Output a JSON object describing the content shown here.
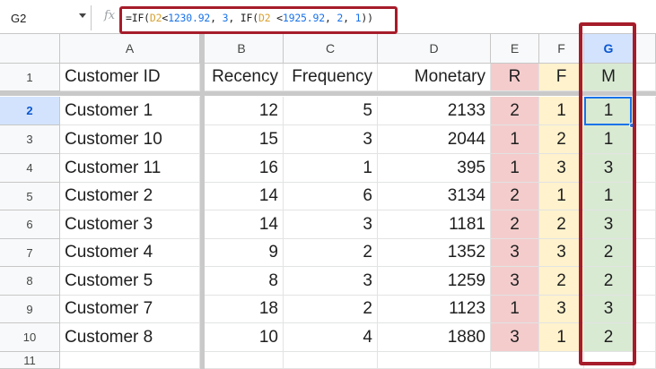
{
  "name_box": {
    "value": "G2"
  },
  "formula_bar": {
    "fx_label": "fx",
    "parts": [
      {
        "text": "=IF(",
        "kind": "plain"
      },
      {
        "text": "D2",
        "kind": "ref"
      },
      {
        "text": "<",
        "kind": "plain"
      },
      {
        "text": "1230.92",
        "kind": "num"
      },
      {
        "text": ", ",
        "kind": "plain"
      },
      {
        "text": "3",
        "kind": "num"
      },
      {
        "text": ", IF(",
        "kind": "plain"
      },
      {
        "text": "D2",
        "kind": "ref"
      },
      {
        "text": " <",
        "kind": "plain"
      },
      {
        "text": "1925.92",
        "kind": "num"
      },
      {
        "text": ", ",
        "kind": "plain"
      },
      {
        "text": "2",
        "kind": "num"
      },
      {
        "text": ", ",
        "kind": "plain"
      },
      {
        "text": "1",
        "kind": "num"
      },
      {
        "text": "))",
        "kind": "plain"
      }
    ]
  },
  "columns": [
    "A",
    "B",
    "C",
    "D",
    "E",
    "F",
    "G"
  ],
  "active_column": "G",
  "active_row": "2",
  "row_numbers": [
    "1",
    "2",
    "3",
    "4",
    "5",
    "6",
    "7",
    "8",
    "9",
    "10",
    "11"
  ],
  "header_row": [
    "Customer ID",
    "Recency",
    "Frequency",
    "Monetary",
    "R",
    "F",
    "M"
  ],
  "rows": [
    [
      "Customer 1",
      "12",
      "5",
      "2133",
      "2",
      "1",
      "1"
    ],
    [
      "Customer 10",
      "15",
      "3",
      "2044",
      "1",
      "2",
      "1"
    ],
    [
      "Customer 11",
      "16",
      "1",
      "395",
      "1",
      "3",
      "3"
    ],
    [
      "Customer 2",
      "14",
      "6",
      "3134",
      "2",
      "1",
      "1"
    ],
    [
      "Customer 3",
      "14",
      "3",
      "1181",
      "2",
      "2",
      "3"
    ],
    [
      "Customer 4",
      "9",
      "2",
      "1352",
      "3",
      "3",
      "2"
    ],
    [
      "Customer 5",
      "8",
      "3",
      "1259",
      "3",
      "2",
      "2"
    ],
    [
      "Customer 7",
      "18",
      "2",
      "1123",
      "1",
      "3",
      "3"
    ],
    [
      "Customer 8",
      "10",
      "4",
      "1880",
      "3",
      "1",
      "2"
    ]
  ],
  "colors": {
    "r_fill": "#f4cccc",
    "f_fill": "#fff2cc",
    "m_fill": "#d9ead3",
    "highlight": "#a61c2a",
    "selection": "#1a73e8"
  }
}
